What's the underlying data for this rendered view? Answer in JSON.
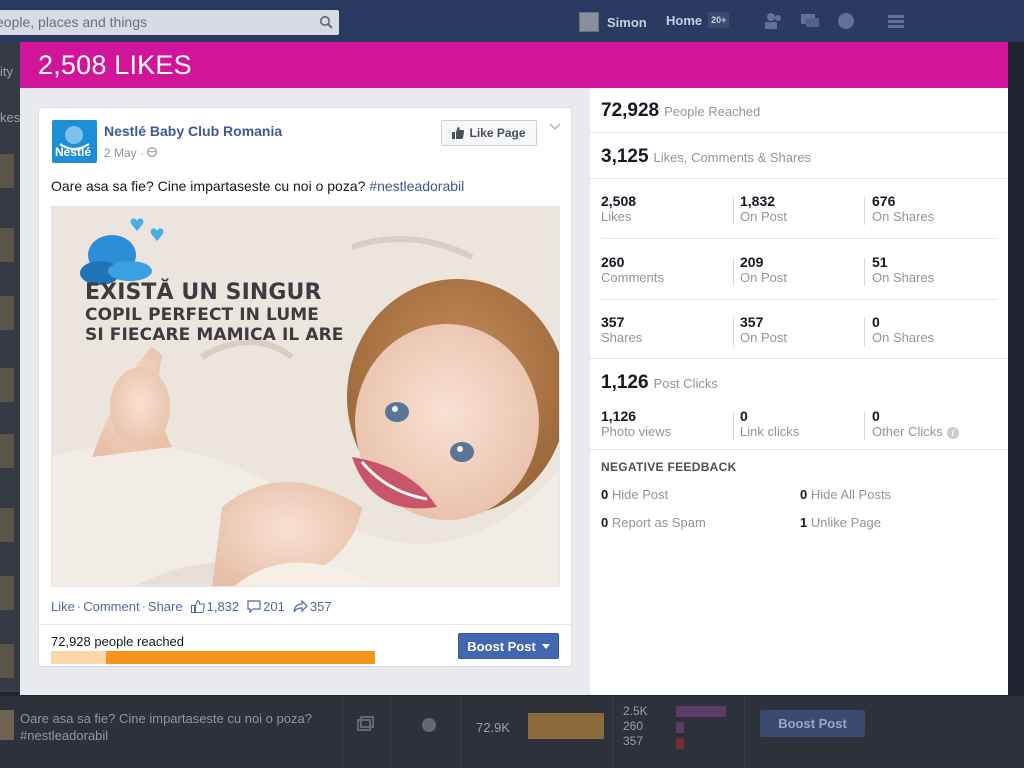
{
  "background": {
    "search_placeholder": "eople, places and things",
    "user_name": "Simon",
    "home_label": "Home",
    "home_count": "20+",
    "left_snippets": [
      "ity",
      "kes"
    ],
    "bottom_post_text": "Oare asa sa fie? Cine impartaseste cu noi o poza? #nestleadorabil",
    "bottom_reach": "72.9K",
    "bottom_mini_stats": [
      "2.5K",
      "260",
      "357"
    ],
    "bottom_boost_label": "Boost Post"
  },
  "modal": {
    "title": "2,508 LIKES"
  },
  "post": {
    "page_name": "Nestlé Baby Club Romania",
    "logo_text": "Nestlé",
    "date": "2 May",
    "like_page_label": "Like Page",
    "text": "Oare asa sa fie? Cine impartaseste cu noi o poza? ",
    "hashtag": "#nestleadorabil",
    "image_caption": [
      "EXISTĂ UN SINGUR",
      "COPIL PERFECT IN LUME",
      "SI FIECARE MAMICA IL ARE"
    ],
    "actions": {
      "like": "Like",
      "comment": "Comment",
      "share": "Share",
      "like_count": "1,832",
      "comment_count": "201",
      "share_count": "357"
    },
    "reached_text": "72,928 people reached",
    "organic_fraction": 0.17,
    "boost_label": "Boost Post"
  },
  "stats": {
    "people_reached": {
      "value": "72,928",
      "label": "People Reached"
    },
    "engagement": {
      "value": "3,125",
      "label": "Likes, Comments & Shares"
    },
    "grid": [
      [
        {
          "n": "2,508",
          "l": "Likes"
        },
        {
          "n": "1,832",
          "l": "On Post"
        },
        {
          "n": "676",
          "l": "On Shares"
        }
      ],
      [
        {
          "n": "260",
          "l": "Comments"
        },
        {
          "n": "209",
          "l": "On Post"
        },
        {
          "n": "51",
          "l": "On Shares"
        }
      ],
      [
        {
          "n": "357",
          "l": "Shares"
        },
        {
          "n": "357",
          "l": "On Post"
        },
        {
          "n": "0",
          "l": "On Shares"
        }
      ]
    ],
    "post_clicks": {
      "value": "1,126",
      "label": "Post Clicks"
    },
    "clicks": [
      {
        "n": "1,126",
        "l": "Photo views"
      },
      {
        "n": "0",
        "l": "Link clicks"
      },
      {
        "n": "0",
        "l": "Other Clicks"
      }
    ],
    "negative_title": "NEGATIVE FEEDBACK",
    "negative": [
      {
        "n": "0",
        "l": "Hide Post"
      },
      {
        "n": "0",
        "l": "Hide All Posts"
      },
      {
        "n": "0",
        "l": "Report as Spam"
      },
      {
        "n": "1",
        "l": "Unlike Page"
      }
    ]
  },
  "colors": {
    "header": "#d1159a",
    "link": "#3b5998",
    "boost": "#4267b2",
    "reach_paid": "#f7941d",
    "reach_organic": "#fbd6a6"
  }
}
